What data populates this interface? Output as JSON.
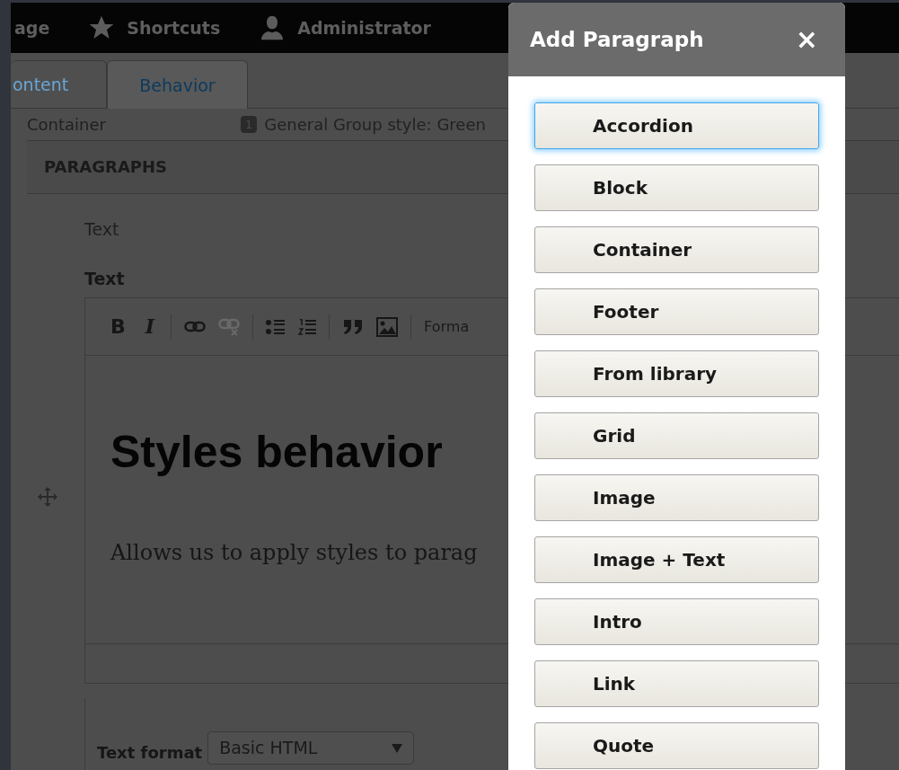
{
  "toolbar": {
    "items": [
      {
        "kind": "text",
        "label": "age"
      },
      {
        "kind": "star",
        "label": "Shortcuts"
      },
      {
        "kind": "user",
        "label": "Administrator"
      }
    ]
  },
  "tabs": [
    {
      "label": "ontent",
      "selected": false
    },
    {
      "label": "Behavior",
      "selected": true
    }
  ],
  "container_row": {
    "label": "Container",
    "badge": "1",
    "summary": "General Group style: Green"
  },
  "section": {
    "title": "PARAGRAPHS"
  },
  "paragraph": {
    "type_label": "Text",
    "field_label": "Text",
    "editor_toolbar": [
      {
        "kind": "bold",
        "label": "B",
        "disabled": false
      },
      {
        "kind": "italic",
        "label": "I",
        "disabled": false
      },
      {
        "kind": "sep"
      },
      {
        "kind": "link",
        "disabled": false
      },
      {
        "kind": "unlink",
        "disabled": true
      },
      {
        "kind": "sep"
      },
      {
        "kind": "bullets",
        "disabled": false
      },
      {
        "kind": "numbers",
        "disabled": false
      },
      {
        "kind": "sep"
      },
      {
        "kind": "quote",
        "disabled": false
      },
      {
        "kind": "image",
        "disabled": false
      },
      {
        "kind": "sep"
      },
      {
        "kind": "format",
        "label": "Forma",
        "disabled": false
      }
    ],
    "heading": "Styles behavior",
    "body": "Allows us to apply styles to parag",
    "text_format": {
      "label": "Text format",
      "value": "Basic HTML"
    }
  },
  "dialog": {
    "title": "Add Paragraph",
    "close": "×",
    "options": [
      {
        "label": "Accordion",
        "focused": true
      },
      {
        "label": "Block",
        "focused": false
      },
      {
        "label": "Container",
        "focused": false
      },
      {
        "label": "Footer",
        "focused": false
      },
      {
        "label": "From library",
        "focused": false
      },
      {
        "label": "Grid",
        "focused": false
      },
      {
        "label": "Image",
        "focused": false
      },
      {
        "label": "Image + Text",
        "focused": false
      },
      {
        "label": "Intro",
        "focused": false
      },
      {
        "label": "Link",
        "focused": false
      },
      {
        "label": "Quote",
        "focused": false
      }
    ]
  }
}
